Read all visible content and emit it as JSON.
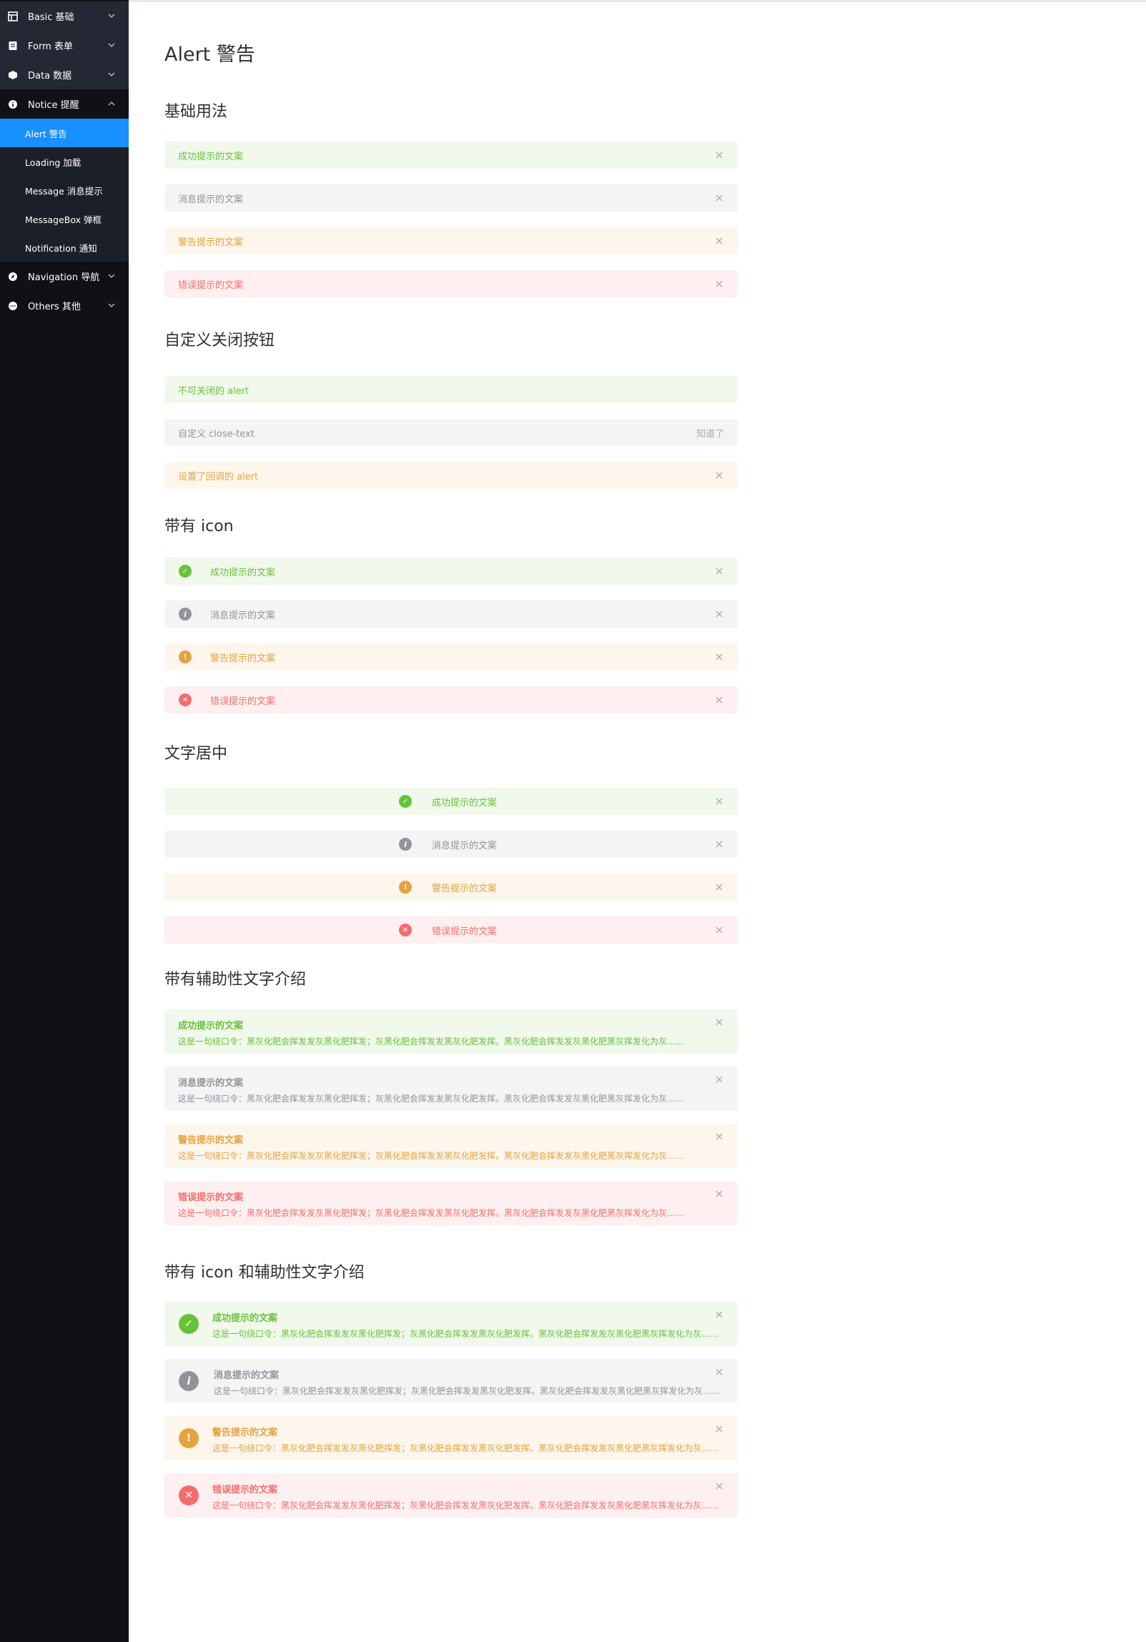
{
  "sidebar": {
    "menus": [
      {
        "label": "Basic 基础",
        "icon": "grid-icon"
      },
      {
        "label": "Form 表单",
        "icon": "form-icon"
      },
      {
        "label": "Data 数据",
        "icon": "data-icon"
      },
      {
        "label": "Notice 提醒",
        "icon": "info-icon"
      },
      {
        "label": "Navigation 导航",
        "icon": "compass-icon"
      },
      {
        "label": "Others 其他",
        "icon": "more-icon"
      }
    ],
    "notice_items": [
      "Alert 警告",
      "Loading 加载",
      "Message 消息提示",
      "MessageBox 弹框",
      "Notification 通知"
    ]
  },
  "page": {
    "title": "Alert 警告"
  },
  "sections": {
    "basic": "基础用法",
    "custom_close": "自定义关闭按钮",
    "with_icon": "带有 icon",
    "center": "文字居中",
    "desc": "带有辅助性文字介绍",
    "icon_desc": "带有 icon 和辅助性文字介绍"
  },
  "alerts": {
    "success": "成功提示的文案",
    "info": "消息提示的文案",
    "warning": "警告提示的文案",
    "error": "错误提示的文案",
    "not_closable": "不可关闭的 alert",
    "custom_close_text": "自定义 close-text",
    "close_text_label": "知道了",
    "callback": "设置了回调的 alert",
    "description": "这是一句绕口令：黑灰化肥会挥发发灰黑化肥挥发；灰黑化肥会挥发发黑灰化肥发挥。黑灰化肥会挥发发灰黑化肥黑灰挥发化为灰……"
  },
  "colors": {
    "success": "#67c23a",
    "info": "#909399",
    "warning": "#e6a23c",
    "error": "#f56c6c",
    "active_menu": "#1890ff"
  }
}
